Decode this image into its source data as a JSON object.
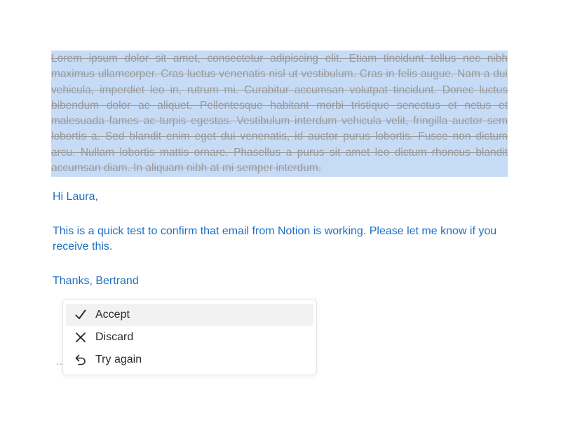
{
  "document": {
    "struck_paragraph": "Lorem ipsum dolor sit amet, consectetur adipiscing elit. Etiam tincidunt tellus nec nibh maximus ullamcorper. Cras luctus venenatis nisl ut vestibulum. Cras in felis augue. Nam a dui vehicula, imperdiet leo in, rutrum mi. Curabitur accumsan volutpat tincidunt. Donec luctus bibendum dolor ac aliquet. Pellentesque habitant morbi tristique senectus et netus et malesuada fames ac turpis egestas. Vestibulum interdum vehicula velit, fringilla auctor sem lobortis a. Sed blandit enim eget dui venenatis, id auctor purus lobortis. Fusce non dictum arcu. Nullam lobortis mattis ornare. Phasellus a purus sit amet leo dictum rhoncus blandit accumsan diam. In aliquam nibh at mi semper interdum.",
    "suggestion": {
      "greeting": "Hi Laura,",
      "body": "This is a quick test to confirm that email from Notion is working. Please let me know if you receive this.",
      "signoff": "Thanks, Bertrand"
    }
  },
  "ellipsis": "...",
  "ai_menu": {
    "items": [
      {
        "label": "Accept",
        "icon": "check-icon"
      },
      {
        "label": "Discard",
        "icon": "close-icon"
      },
      {
        "label": "Try again",
        "icon": "undo-arrow-icon"
      }
    ]
  },
  "colors": {
    "selection": "#c6dbf6",
    "suggestion_text": "#1f6fc1",
    "struck_text": "#9a9a9a",
    "menu_hover": "#f2f2f2"
  }
}
